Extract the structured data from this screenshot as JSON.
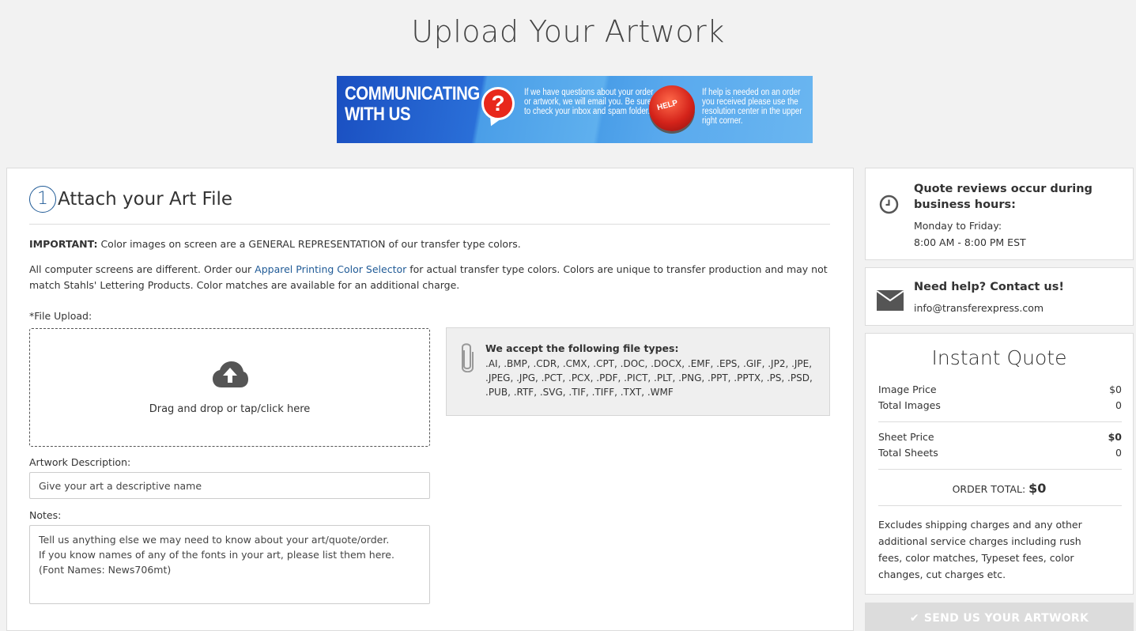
{
  "page": {
    "title": "Upload Your Artwork"
  },
  "banner": {
    "title_line1": "COMMUNICATING",
    "title_line2": "WITH US",
    "question_mark": "?",
    "text1": "If we have questions about your order or artwork, we will email you. Be sure to check your inbox and spam folder.",
    "help_label": "HELP",
    "text2": "If help is needed on an order you received please use the resolution center in the upper right corner."
  },
  "step": {
    "number": "1",
    "title": "Attach your Art File",
    "important_label": "IMPORTANT:",
    "important_text": " Color images on screen are a GENERAL REPRESENTATION of our transfer type colors.",
    "para_before": "All computer screens are different. Order our ",
    "para_link": "Apparel Printing Color Selector",
    "para_after": " for actual transfer type colors. Colors are unique to transfer production and may not match Stahls' Lettering Products. Color matches are available for an additional charge."
  },
  "upload": {
    "label": "*File Upload:",
    "dropzone_text": "Drag and drop or tap/click here",
    "filetypes_title": "We accept the following file types:",
    "filetypes_list": ".AI, .BMP, .CDR, .CMX, .CPT, .DOC, .DOCX, .EMF, .EPS, .GIF, .JP2, .JPE, .JPEG, .JPG, .PCT, .PCX, .PDF, .PICT, .PLT, .PNG, .PPT, .PPTX, .PS, .PSD, .PUB, .RTF, .SVG, .TIF, .TIFF, .TXT, .WMF"
  },
  "form": {
    "description_label": "Artwork Description:",
    "description_placeholder": "Give your art a descriptive name",
    "notes_label": "Notes:",
    "notes_placeholder": "Tell us anything else we may need to know about your art/quote/order.\nIf you know names of any of the fonts in your art, please list them here.\n(Font Names: News706mt)"
  },
  "hours": {
    "title": "Quote reviews occur during business hours:",
    "line1": "Monday to Friday:",
    "line2": "8:00 AM - 8:00 PM EST"
  },
  "contact": {
    "title": "Need help? Contact us!",
    "email": "info@transferexpress.com"
  },
  "quote": {
    "title": "Instant Quote",
    "image_price_label": "Image Price",
    "image_price_value": "$0",
    "total_images_label": "Total Images",
    "total_images_value": "0",
    "sheet_price_label": "Sheet Price",
    "sheet_price_value": "$0",
    "total_sheets_label": "Total Sheets",
    "total_sheets_value": "0",
    "order_total_label": "ORDER TOTAL:",
    "order_total_value": "$0",
    "excludes": "Excludes shipping charges and any other additional service charges including rush fees, color matches, Typeset fees, color changes, cut charges etc."
  },
  "send_button": {
    "check": "✔",
    "label": "SEND US YOUR ARTWORK"
  },
  "colors": {
    "accent": "#1f5a96",
    "button_disabled": "#dcdcdc",
    "background": "#f2f2f2"
  }
}
